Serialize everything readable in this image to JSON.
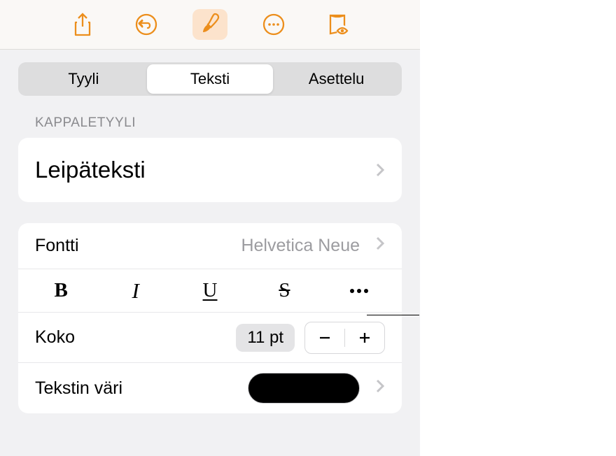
{
  "tabs": {
    "style": "Tyyli",
    "text": "Teksti",
    "layout": "Asettelu"
  },
  "section": {
    "paragraphStyle": "KAPPALETYYLI"
  },
  "paragraphStyle": {
    "value": "Leipäteksti"
  },
  "font": {
    "label": "Fontti",
    "value": "Helvetica Neue"
  },
  "styleButtons": {
    "bold": "B",
    "italic": "I",
    "underline": "U",
    "strike": "S"
  },
  "size": {
    "label": "Koko",
    "value": "11 pt"
  },
  "textColor": {
    "label": "Tekstin väri",
    "value": "#000000"
  }
}
